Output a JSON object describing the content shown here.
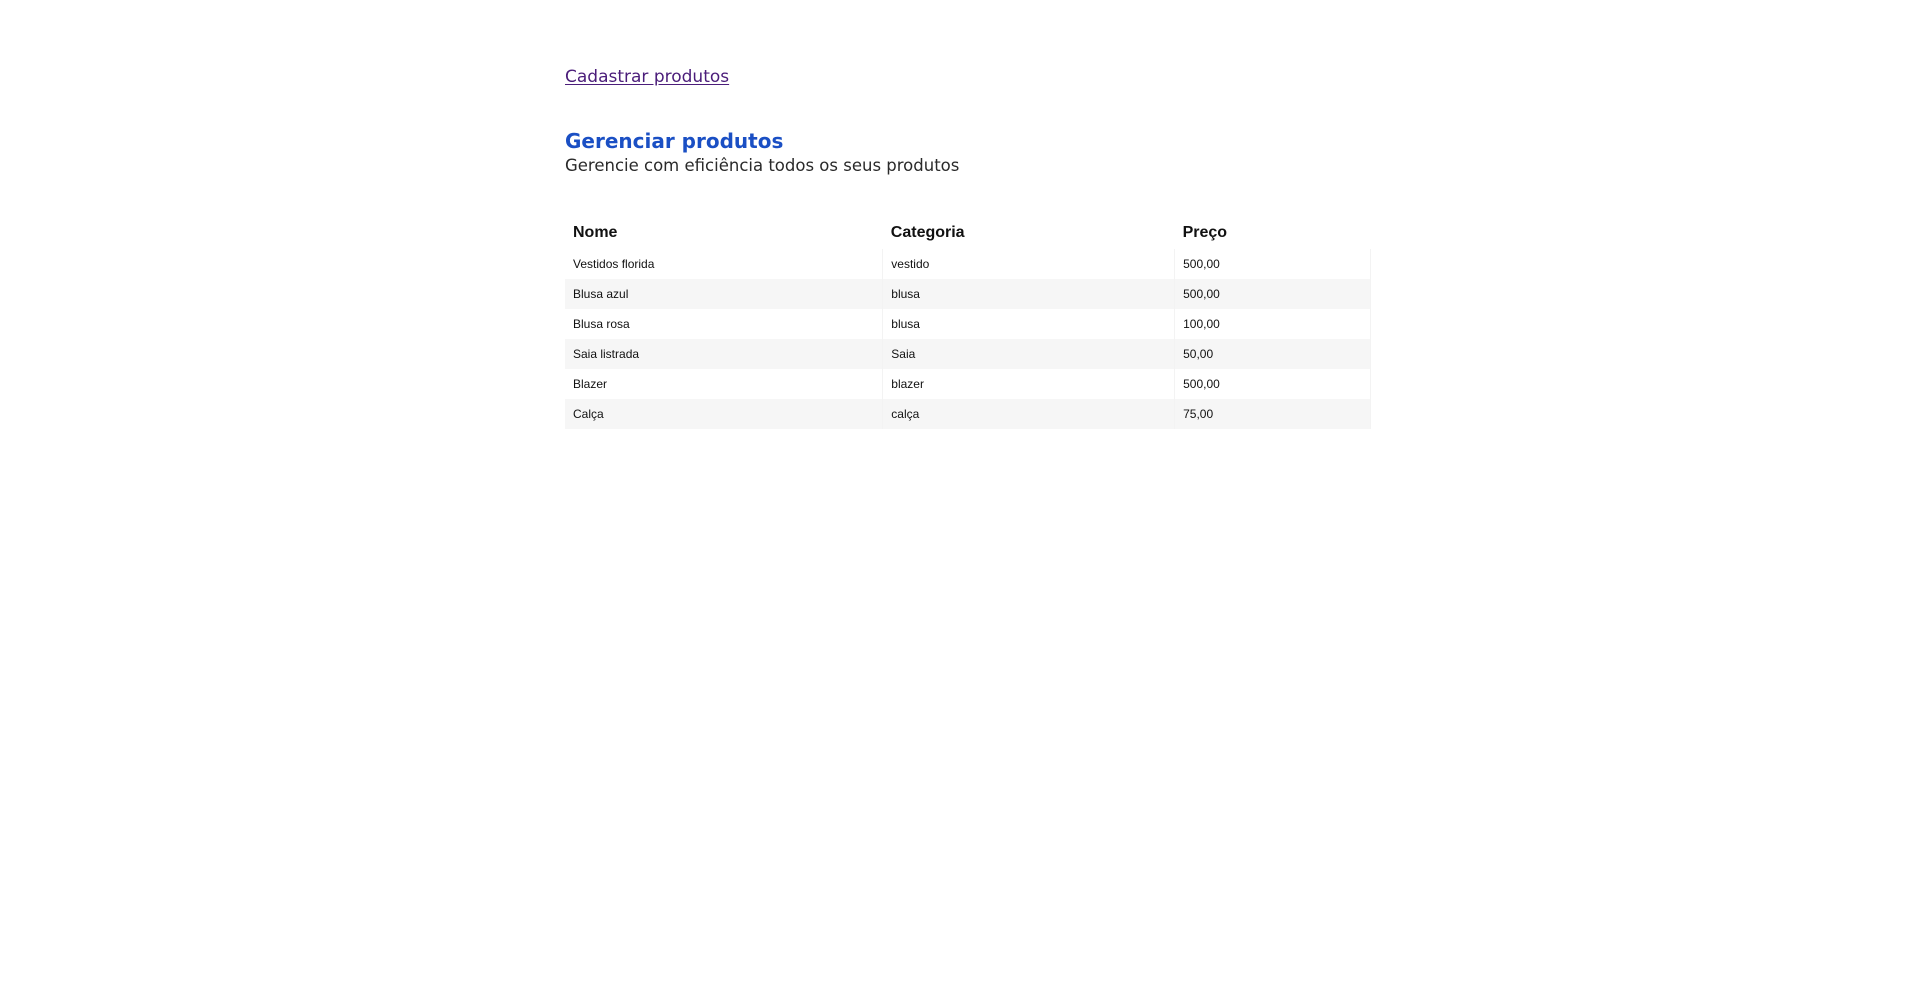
{
  "header": {
    "register_link": "Cadastrar produtos"
  },
  "section": {
    "title": "Gerenciar produtos",
    "subtitle": "Gerencie com eficiência todos os seus produtos"
  },
  "table": {
    "columns": [
      "Nome",
      "Categoria",
      "Preço"
    ],
    "rows": [
      [
        "Vestidos florida",
        "vestido",
        "500,00"
      ],
      [
        "Blusa azul",
        "blusa",
        "500,00"
      ],
      [
        "Blusa rosa",
        "blusa",
        "100,00"
      ],
      [
        "Saia listrada",
        "Saia",
        "50,00"
      ],
      [
        "Blazer",
        "blazer",
        "500,00"
      ],
      [
        "Calça",
        "calça",
        "75,00"
      ]
    ]
  }
}
